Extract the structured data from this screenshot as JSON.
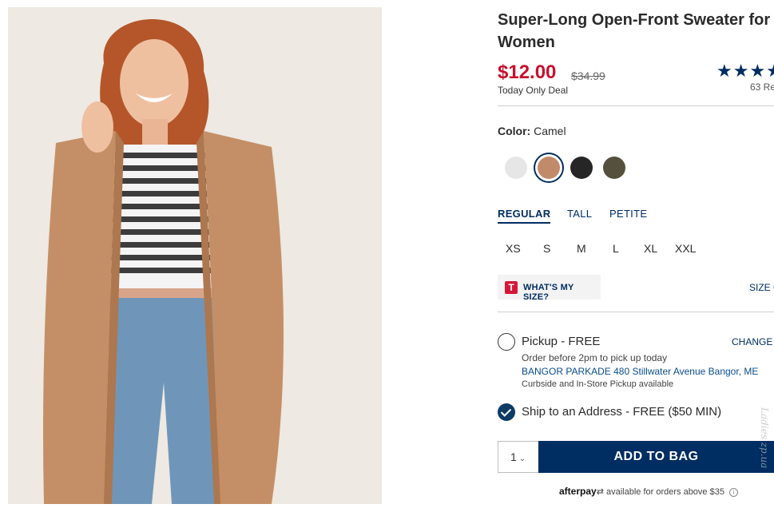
{
  "product": {
    "title": "Super-Long Open-Front Sweater for Women",
    "sale_price": "$12.00",
    "original_price": "$34.99",
    "deal_label": "Today Only Deal",
    "rating_stars": "★★★★",
    "reviews": "63 Re"
  },
  "color": {
    "label": "Color:",
    "selected": "Camel",
    "swatches": [
      {
        "name": "light-gray",
        "hex": "#e6e6e6"
      },
      {
        "name": "camel",
        "hex": "#c18a6a"
      },
      {
        "name": "black",
        "hex": "#262626"
      },
      {
        "name": "olive",
        "hex": "#55503d"
      }
    ]
  },
  "fit_tabs": [
    "REGULAR",
    "TALL",
    "PETITE"
  ],
  "sizes": [
    "XS",
    "S",
    "M",
    "L",
    "XL",
    "XXL"
  ],
  "size_help": {
    "logo_letter": "T",
    "whats_my_size": "WHAT'S MY SIZE?",
    "size_chart": "SIZE C"
  },
  "fulfillment": {
    "pickup_label": "Pickup - FREE",
    "change_store": "CHANGE S",
    "pickup_note": "Order before 2pm to pick up today",
    "store_address": "BANGOR PARKADE 480 Stillwater Avenue  Bangor, ME",
    "curbside_note": "Curbside and In-Store Pickup available",
    "ship_label": "Ship to an Address - FREE ($50 MIN)"
  },
  "purchase": {
    "quantity": "1",
    "add_to_bag": "ADD TO BAG",
    "afterpay_brand": "afterpay",
    "afterpay_note": "available for orders above $35"
  },
  "accent_colors": {
    "navy": "#002d62",
    "sale_red": "#c8102e"
  },
  "watermark": "Ladies zp.ua"
}
